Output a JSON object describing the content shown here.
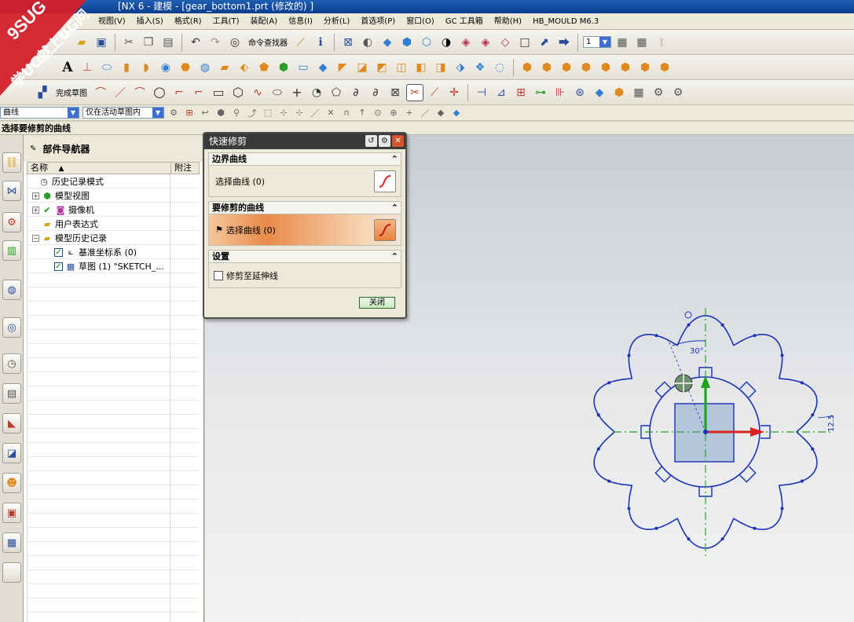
{
  "window": {
    "title": "[NX 6 - 建模 - [gear_bottom1.prt  (修改的) ]"
  },
  "watermark": {
    "brand": "9SUG",
    "slogan": "学UG就上UG网"
  },
  "menubar": {
    "items": [
      {
        "label": "视图(V)"
      },
      {
        "label": "插入(S)"
      },
      {
        "label": "格式(R)"
      },
      {
        "label": "工具(T)"
      },
      {
        "label": "装配(A)"
      },
      {
        "label": "信息(I)"
      },
      {
        "label": "分析(L)"
      },
      {
        "label": "首选项(P)"
      },
      {
        "label": "窗口(O)"
      },
      {
        "label": "GC 工具箱"
      },
      {
        "label": "帮助(H)"
      },
      {
        "label": "HB_MOULD M6.3"
      }
    ]
  },
  "toolbar": {
    "command_finder": "命令查找器",
    "finish_sketch": "完成草图",
    "layer_value": "1"
  },
  "selection_bar": {
    "filter_value": "曲线",
    "scope_value": "仅在活动草图内"
  },
  "prompt": {
    "text": "选择要修剪的曲线"
  },
  "navigator": {
    "title": "部件导航器",
    "col_name": "名称",
    "col_sort": "▲",
    "col_note": "附注",
    "items": [
      {
        "label": "历史记录模式"
      },
      {
        "label": "模型视图"
      },
      {
        "label": "摄像机"
      },
      {
        "label": "用户表达式"
      },
      {
        "label": "模型历史记录"
      },
      {
        "label": "基准坐标系 (0)"
      },
      {
        "label": "草图 (1) \"SKETCH_..."
      }
    ]
  },
  "dialog": {
    "title": "快速修剪",
    "group_boundary": "边界曲线",
    "boundary_select": "选择曲线 (0)",
    "group_trim": "要修剪的曲线",
    "trim_select": "选择曲线 (0)",
    "group_settings": "设置",
    "extend_option": "修剪至延伸线",
    "close_button": "关闭"
  },
  "sketch": {
    "angle_dim": "30°",
    "linear_dim": "12.5",
    "colors": {
      "curve": "#1a33b8",
      "axis_y": "#19a519",
      "axis_x": "#d9251c",
      "center_line": "#2aa52a",
      "square_fill": "#9cb6d4"
    }
  }
}
